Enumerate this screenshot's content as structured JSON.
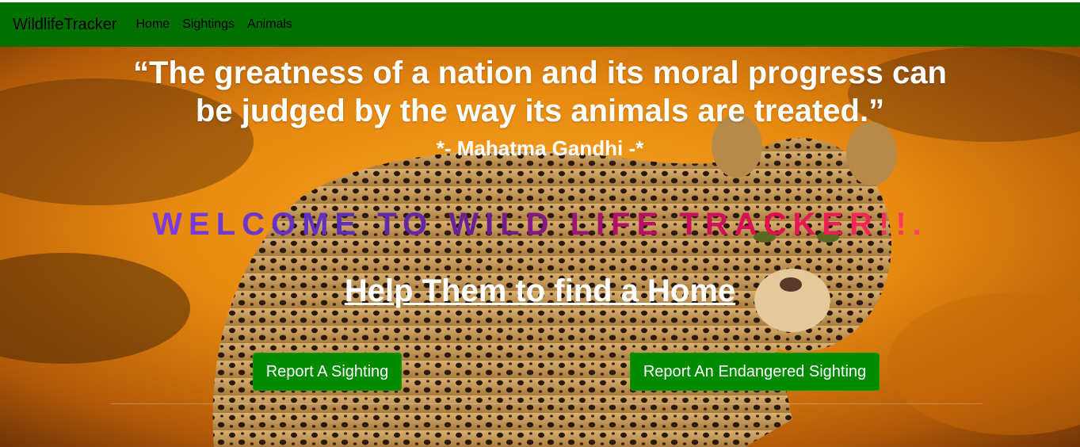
{
  "navbar": {
    "brand": "WildlifeTracker",
    "links": [
      "Home",
      "Sightings",
      "Animals"
    ],
    "color": "#007000"
  },
  "hero": {
    "quote_line1": "“The greatness of a nation and its moral progress can",
    "quote_line2": "be judged by the way its animals are treated.”",
    "author": "*- Mahatma Gandhi -*",
    "welcome": "WELCOME TO WILD LIFE TRACKER!!.",
    "help": "Help Them to find a Home",
    "image_subject": "leopard"
  },
  "buttons": {
    "sighting": "Report A Sighting",
    "endangered": "Report An Endangered Sighting",
    "color": "#008a00"
  },
  "welcome_gradient": [
    "#7a3ce0",
    "#5c2fb8",
    "#6a1f8f",
    "#b0106a",
    "#e01050",
    "#ff4060"
  ]
}
